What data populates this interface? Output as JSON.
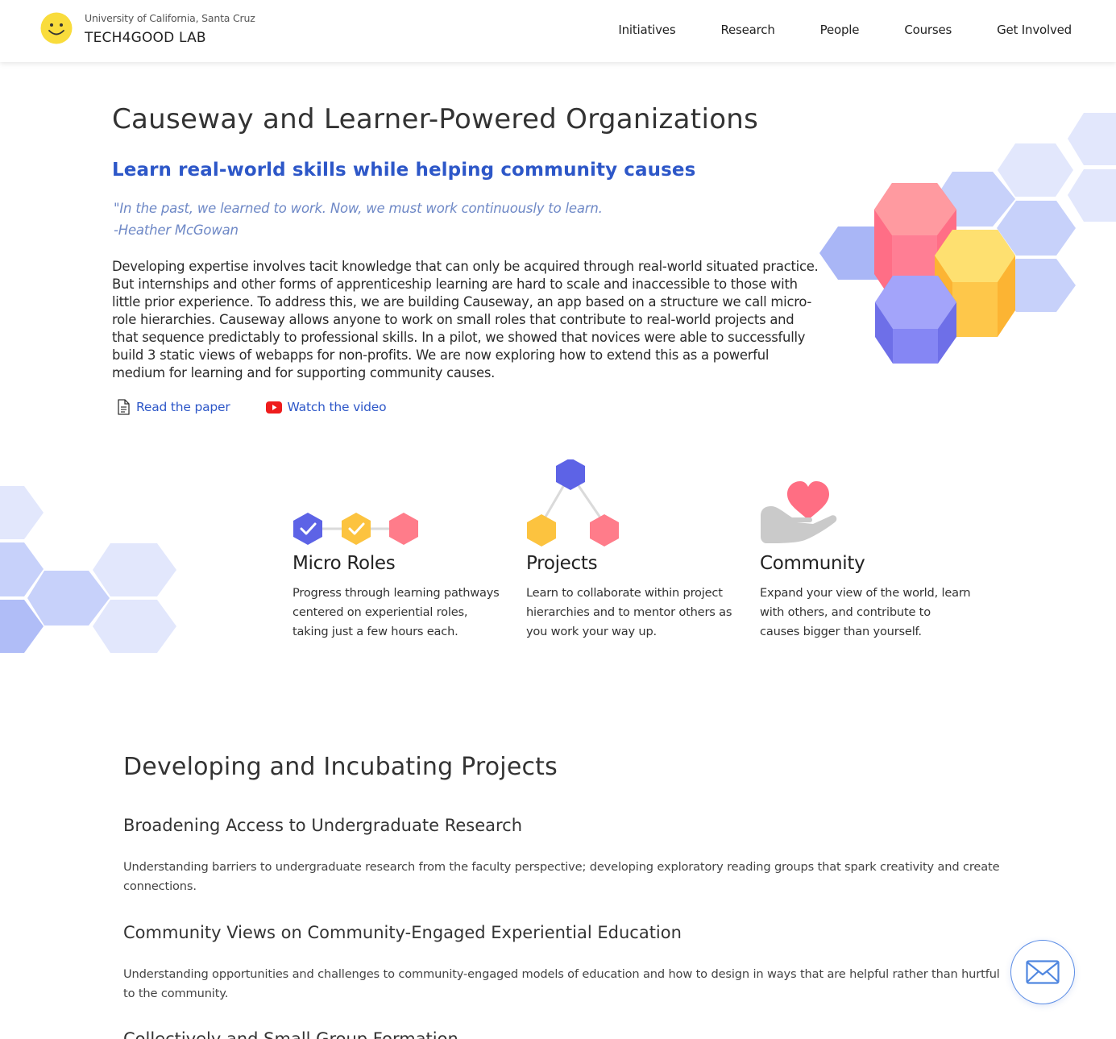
{
  "header": {
    "university": "University of California, Santa Cruz",
    "lab_name": "TECH4GOOD LAB",
    "nav": [
      "Initiatives",
      "Research",
      "People",
      "Courses",
      "Get Involved"
    ]
  },
  "hero": {
    "title": "Causeway and Learner-Powered Organizations",
    "subtitle": "Learn real-world skills while helping community causes",
    "quote_line1": "\"In the past, we learned to work. Now, we must work continuously to learn.",
    "quote_line2": "-Heather McGowan",
    "paragraph": "Developing expertise involves tacit knowledge that can only be acquired through real-world situated practice. But internships and other forms of apprenticeship learning are hard to scale and inaccessible to those with little prior experience. To address this, we are building Causeway, an app based on a structure we call micro-role hierarchies. Causeway allows anyone to work on small roles that contribute to real-world projects and that sequence predictably to professional skills. In a pilot, we showed that novices were able to successfully build 3 static views of webapps for non-profits. We are now exploring how to extend this as a powerful medium for learning and for supporting community causes.",
    "link_paper": "Read the paper",
    "link_video": "Watch the video"
  },
  "features": [
    {
      "title": "Micro Roles",
      "text": "Progress through learning pathways centered on experiential roles, taking just a few hours each."
    },
    {
      "title": "Projects",
      "text": "Learn to collaborate within project hierarchies and to mentor others as you work your way up."
    },
    {
      "title": "Community",
      "text": "Expand your view of the world, learn with others, and contribute to causes bigger than yourself."
    }
  ],
  "projects": {
    "section_title": "Developing and Incubating Projects",
    "items": [
      {
        "title": "Broadening Access to Undergraduate Research",
        "description": "Understanding barriers to undergraduate research from the faculty perspective; developing exploratory reading groups that spark creativity and create connections."
      },
      {
        "title": "Community Views on Community-Engaged Experiential Education",
        "description": "Understanding opportunities and challenges to community-engaged models of education and how to design in ways that are helpful rather than hurtful to the community."
      },
      {
        "title": "Collectively and Small Group Formation"
      }
    ]
  },
  "colors": {
    "accent_blue": "#2d57c8",
    "quote_blue": "#6e88c6",
    "hex_purple": "#7b7ef0",
    "hex_yellow": "#fcc64a",
    "hex_pink": "#ff8a95",
    "hex_light": "#dfe5fb"
  },
  "icons": {
    "logo": "smiley-face-icon",
    "paper": "document-icon",
    "video": "youtube-play-icon",
    "mail": "envelope-icon"
  }
}
